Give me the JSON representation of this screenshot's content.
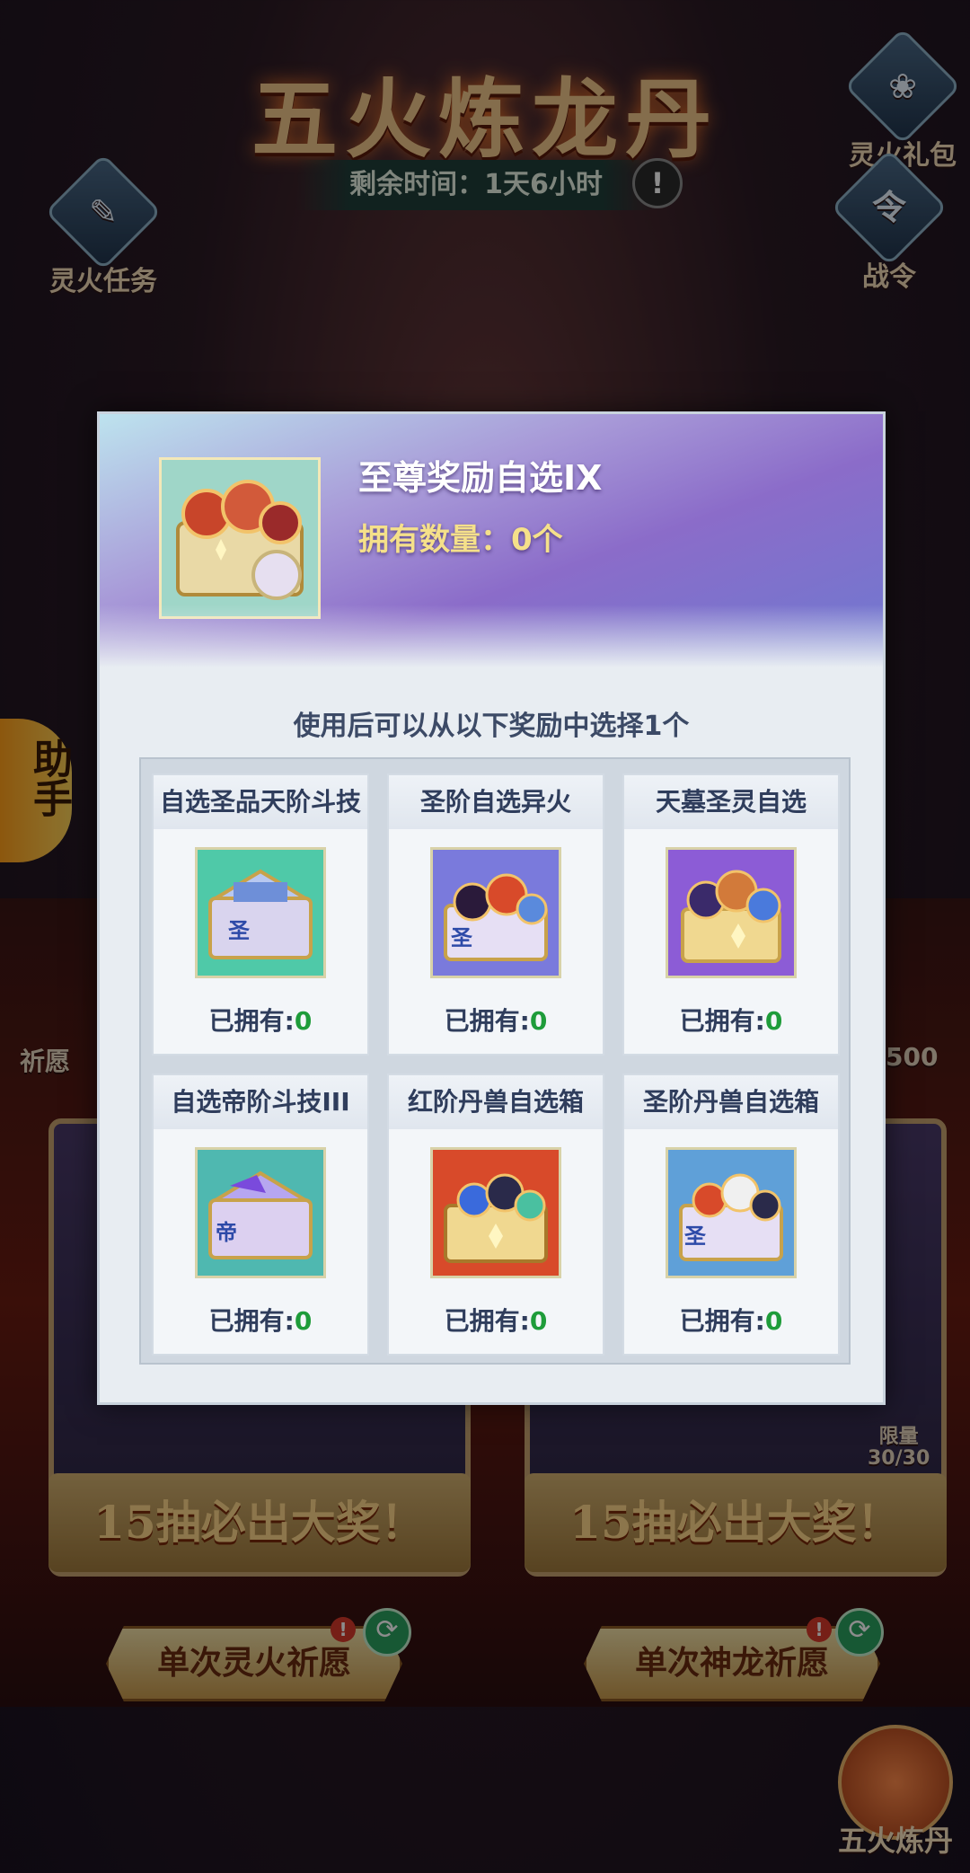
{
  "header": {
    "title": "五火炼龙丹",
    "remaining_time": "剩余时间：1天6小时",
    "warn_symbol": "!"
  },
  "corner_buttons": {
    "left_top": {
      "label": "灵火任务",
      "icon": "scroll-icon"
    },
    "right_top": {
      "label": "灵火礼包",
      "icon": "gift-icon"
    },
    "right_second": {
      "label": "战令",
      "icon": "pass-icon"
    }
  },
  "side_tab": {
    "label": "助手"
  },
  "background": {
    "partial_left_label": "祈愿",
    "partial_right_value": "500",
    "left_panel_banner": "15抽必出大奖！",
    "right_panel_banner": "15抽必出大奖！",
    "right_panel_limit": "30/30",
    "right_panel_limit_label": "限量",
    "left_pray_button": "单次灵火祈愿",
    "right_pray_button": "单次神龙祈愿",
    "bottom_corner_label": "五火炼丹"
  },
  "modal": {
    "item_name": "至尊奖励自选IX",
    "owned_count": "拥有数量：0个",
    "description": "使用后可以从以下奖励中选择1个",
    "owned_prefix": "已拥有:",
    "options": [
      {
        "title": "自选圣品天阶斗技",
        "owned": "0",
        "badge": "圣",
        "theme": "#4fc9a8"
      },
      {
        "title": "圣阶自选异火",
        "owned": "0",
        "badge": "圣",
        "theme": "#7a7adc"
      },
      {
        "title": "天墓圣灵自选",
        "owned": "0",
        "badge": "",
        "theme": "#8c5cd6"
      },
      {
        "title": "自选帝阶斗技III",
        "owned": "0",
        "badge": "帝",
        "theme": "#4fb8b0"
      },
      {
        "title": "红阶丹兽自选箱",
        "owned": "0",
        "badge": "",
        "theme": "#d84a2a"
      },
      {
        "title": "圣阶丹兽自选箱",
        "owned": "0",
        "badge": "圣",
        "theme": "#5fa0d8"
      }
    ]
  }
}
